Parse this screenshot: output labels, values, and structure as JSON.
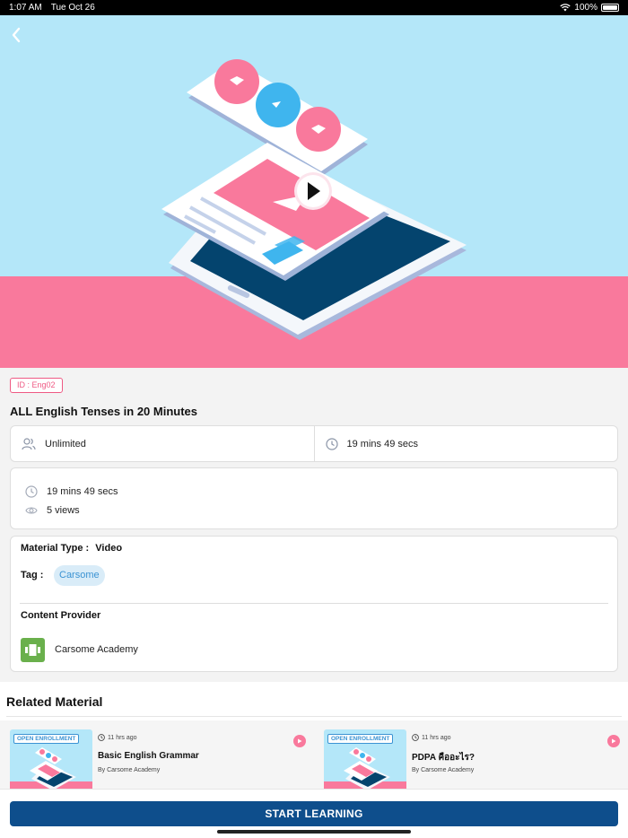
{
  "status_bar": {
    "time": "1:07 AM",
    "date": "Tue Oct 26",
    "battery": "100%"
  },
  "course": {
    "id_badge": "ID : Eng02",
    "title": "ALL English Tenses in 20 Minutes",
    "seats": "Unlimited",
    "duration": "19 mins 49 secs",
    "info_duration": "19 mins 49 secs",
    "views": "5 views",
    "material_type_label": "Material Type :",
    "material_type_value": "Video",
    "tag_label": "Tag :",
    "tag_value": "Carsome",
    "provider_label": "Content Provider",
    "provider_name": "Carsome Academy"
  },
  "related": {
    "title": "Related Material",
    "items": [
      {
        "badge": "OPEN ENROLLMENT",
        "time": "11 hrs ago",
        "title": "Basic English Grammar",
        "by": "By Carsome Academy"
      },
      {
        "badge": "OPEN ENROLLMENT",
        "time": "11 hrs ago",
        "title": "PDPA คืออะไร?",
        "by": "By Carsome Academy"
      }
    ]
  },
  "actions": {
    "start_label": "START LEARNING"
  },
  "colors": {
    "accent": "#0e4e8c",
    "pink": "#f9799c",
    "sky": "#b4e7f9",
    "tag_bg": "#d9ecf8",
    "provider_green": "#6ab04c"
  },
  "icons": [
    "back-chevron-icon",
    "wifi-icon",
    "battery-icon",
    "users-icon",
    "clock-icon",
    "eye-icon",
    "play-icon",
    "provider-logo-icon"
  ]
}
